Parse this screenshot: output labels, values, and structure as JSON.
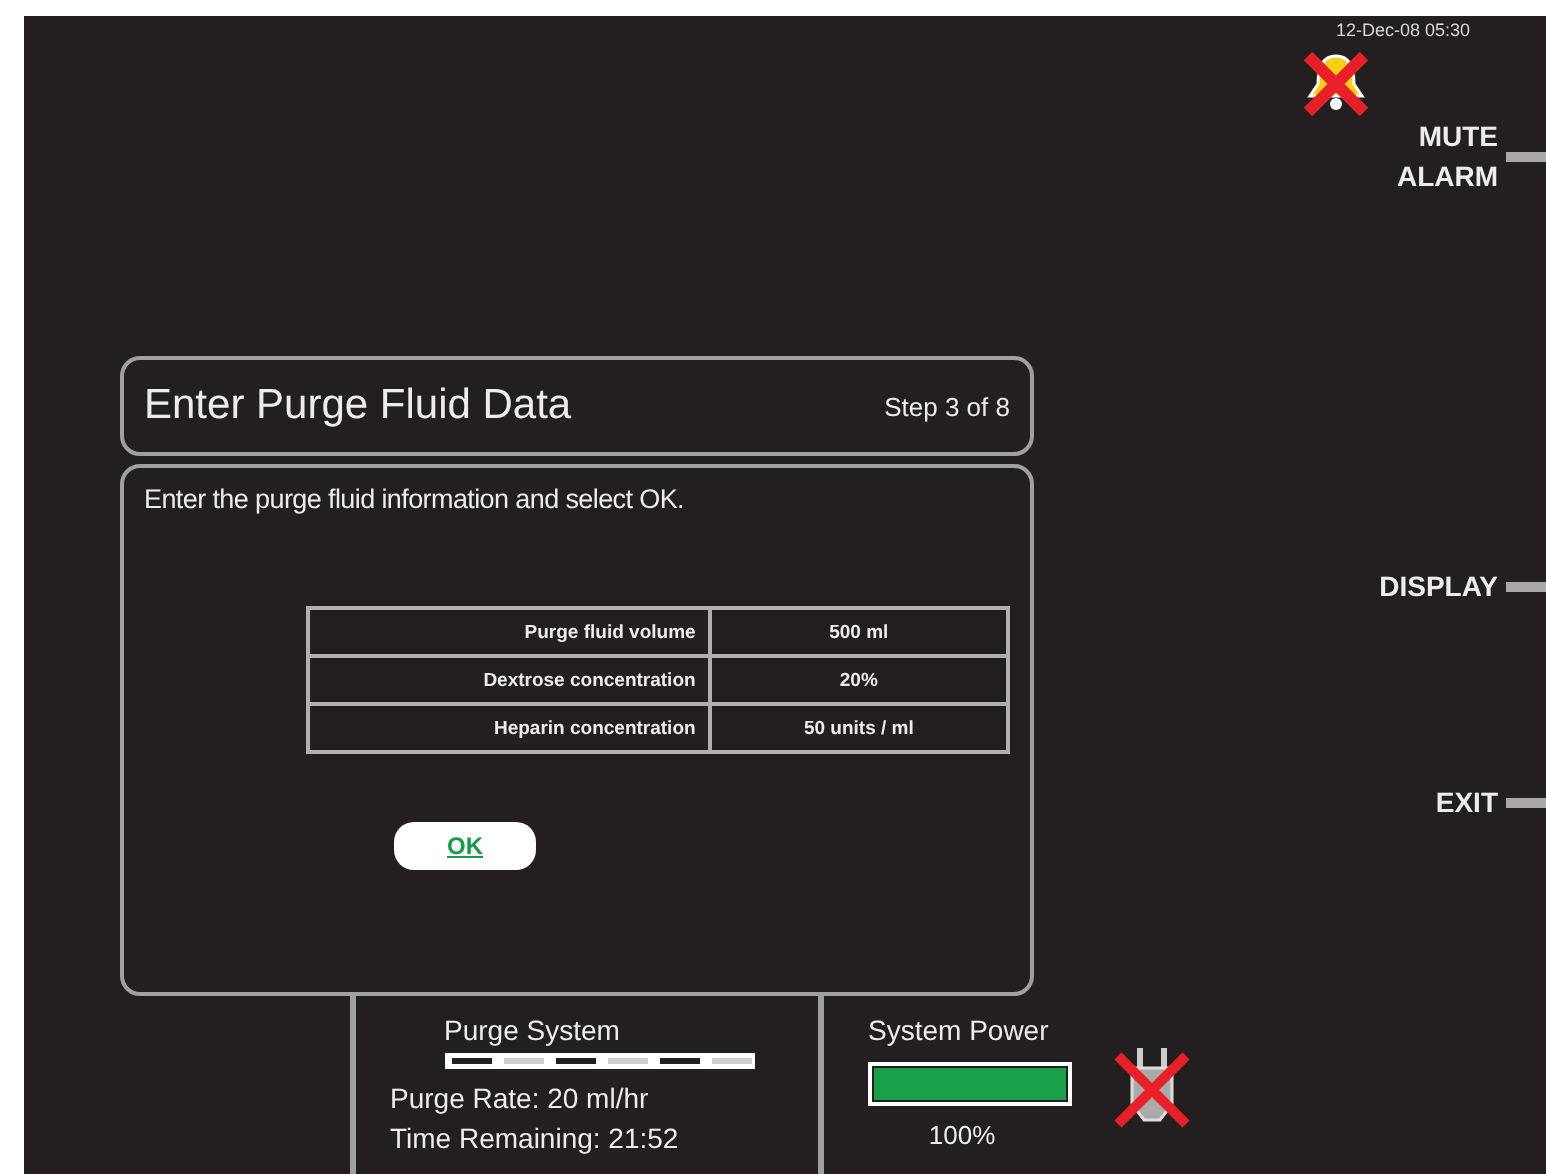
{
  "datetime": "12-Dec-08 05:30",
  "alarm_muted": true,
  "soft_keys": [
    {
      "label": "MUTE ALARM"
    },
    {
      "label": "DISPLAY"
    },
    {
      "label": "EXIT"
    }
  ],
  "dialog": {
    "title": "Enter Purge Fluid Data",
    "step": "Step 3 of 8",
    "instruction": "Enter the purge fluid information and select OK.",
    "fields": [
      {
        "label": "Purge fluid volume",
        "value": "500 ml"
      },
      {
        "label": "Dextrose concentration",
        "value": "20%"
      },
      {
        "label": "Heparin concentration",
        "value": "50 units / ml"
      }
    ],
    "ok_button": "OK"
  },
  "purge_system": {
    "title": "Purge System",
    "rate": "Purge Rate: 20 ml/hr",
    "time_remaining": "Time Remaining: 21:52"
  },
  "system_power": {
    "title": "System Power",
    "level": 1,
    "reading": "100%",
    "ac_connected": false
  }
}
